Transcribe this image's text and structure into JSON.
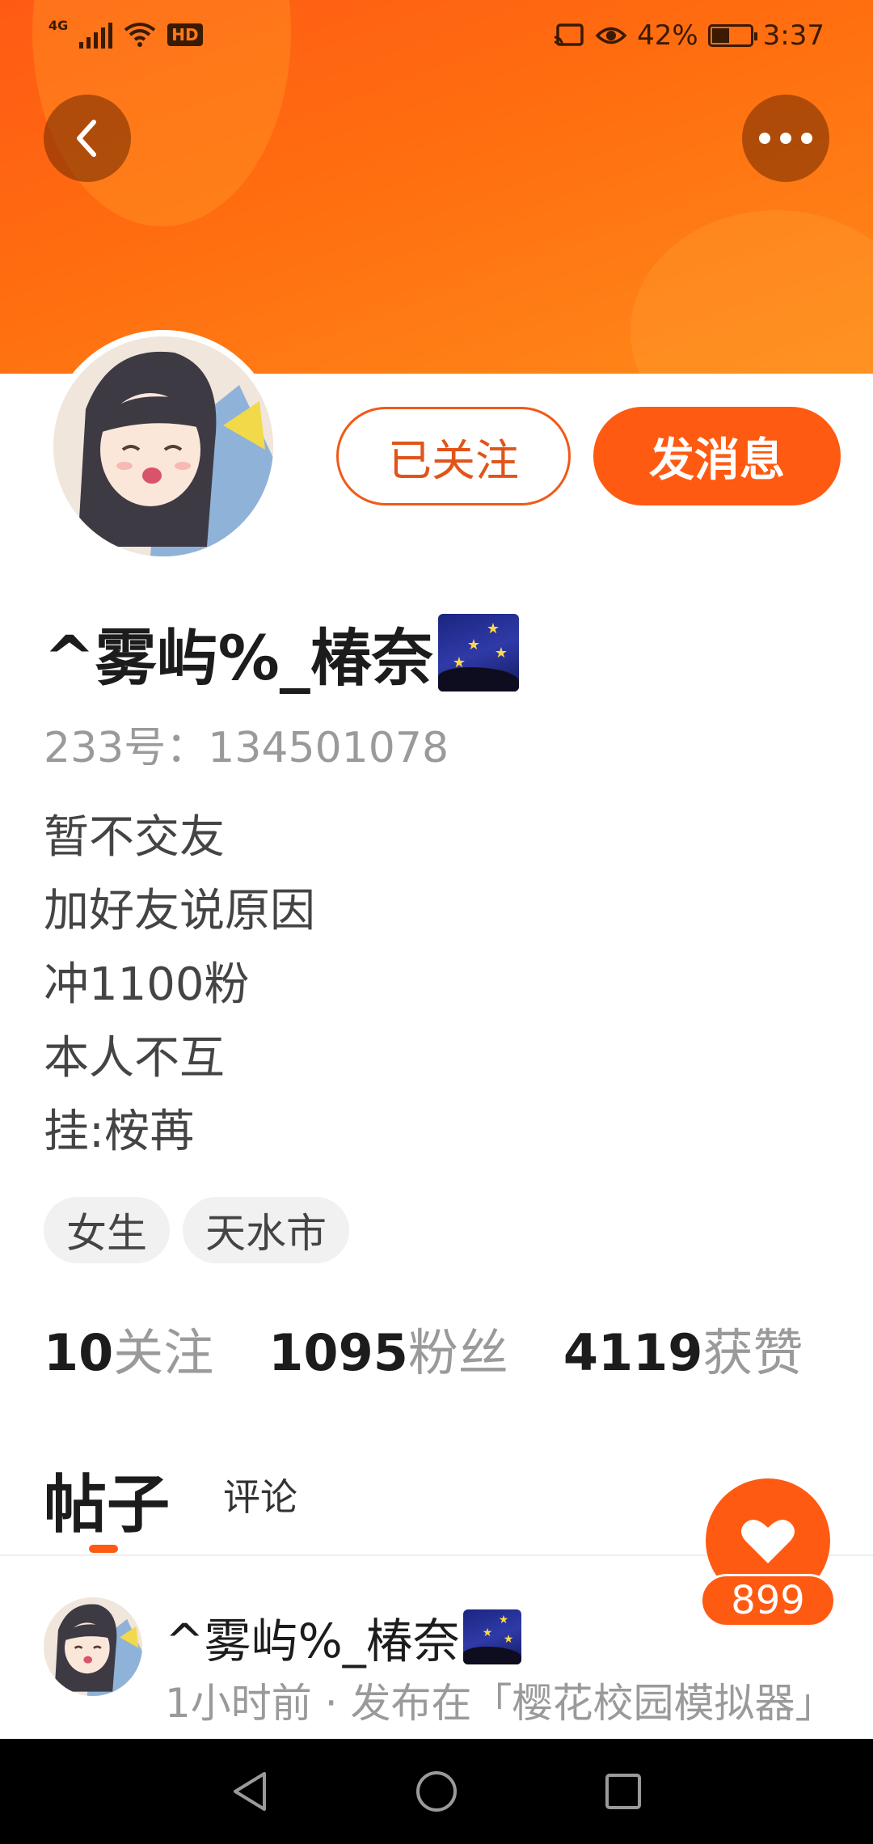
{
  "status_bar": {
    "network": "4G",
    "hd": "HD",
    "battery_percent": "42%",
    "battery_level": 0.42,
    "time": "3:37"
  },
  "header": {
    "back_icon": "chevron-left-icon",
    "more_icon": "more-horizontal-icon"
  },
  "profile": {
    "follow_button": "已关注",
    "message_button": "发消息",
    "username": "^雾屿%_椿奈",
    "username_emoji": "milky-way-night-emoji",
    "id_label": "233号：",
    "id_value": "134501078",
    "bio": [
      "暂不交友",
      "加好友说原因",
      "冲1100粉",
      "本人不互",
      "挂:桉苒"
    ],
    "tags": [
      "女生",
      "天水市"
    ],
    "stats": [
      {
        "value": "10",
        "label": "关注"
      },
      {
        "value": "1095",
        "label": "粉丝"
      },
      {
        "value": "4119",
        "label": "获赞"
      }
    ]
  },
  "tabs": {
    "posts": "帖子",
    "comments": "评论"
  },
  "like": {
    "icon": "heart-icon",
    "count": "899"
  },
  "post": {
    "author": "^雾屿%_椿奈",
    "meta": "1小时前 · 发布在「樱花校园模拟器」"
  },
  "colors": {
    "accent": "#ff5a12",
    "header_gradient_start": "#ff5a14",
    "header_gradient_end": "#ff8a1a"
  }
}
